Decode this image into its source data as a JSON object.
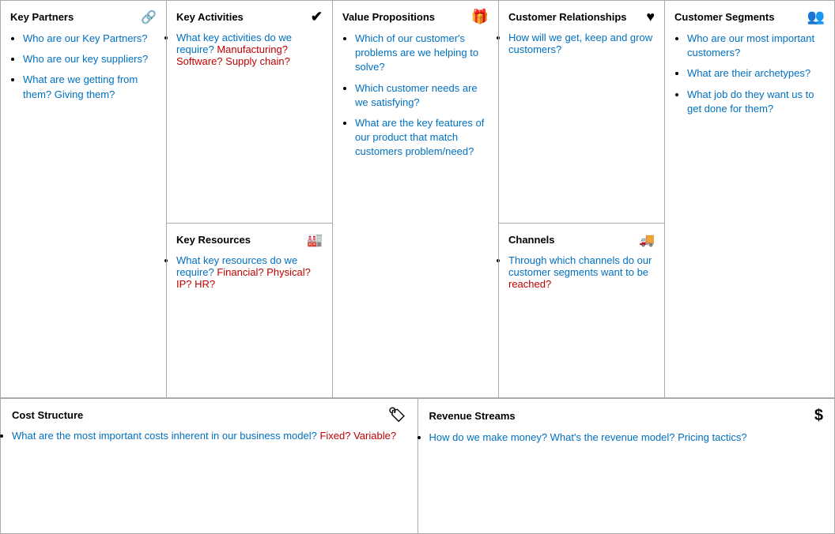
{
  "sections": {
    "keyPartners": {
      "title": "Key Partners",
      "icon": "link-icon",
      "items": [
        {
          "parts": [
            {
              "text": "Who are our Key Partners?",
              "color": "blue"
            }
          ]
        },
        {
          "parts": [
            {
              "text": "Who are our key suppliers?",
              "color": "blue"
            }
          ]
        },
        {
          "parts": [
            {
              "text": "What are we getting from them? Giving them?",
              "color": "blue"
            }
          ]
        }
      ]
    },
    "keyActivities": {
      "title": "Key Activities",
      "icon": "check-icon",
      "items": [
        {
          "parts": [
            {
              "text": "What key activities do we require? ",
              "color": "blue"
            },
            {
              "text": "Manufacturing? Software? Supply chain?",
              "color": "red"
            }
          ]
        }
      ]
    },
    "keyResources": {
      "title": "Key Resources",
      "icon": "factory-icon",
      "items": [
        {
          "parts": [
            {
              "text": "What key resources do we require? ",
              "color": "blue"
            },
            {
              "text": "Financial? Physical? IP? HR?",
              "color": "red"
            }
          ]
        }
      ]
    },
    "valuePropositions": {
      "title": "Value Propositions",
      "icon": "gift-icon",
      "items": [
        {
          "parts": [
            {
              "text": "Which of our customer's problems are we helping to solve?",
              "color": "blue"
            }
          ]
        },
        {
          "parts": [
            {
              "text": "Which customer needs are we satisfying?",
              "color": "blue"
            }
          ]
        },
        {
          "parts": [
            {
              "text": "What are the key features of our product that match customers problem/need?",
              "color": "blue"
            }
          ]
        }
      ]
    },
    "customerRelationships": {
      "title": "Customer Relationships",
      "icon": "heart-icon",
      "items": [
        {
          "parts": [
            {
              "text": "How will we get, keep and grow customers?",
              "color": "blue"
            }
          ]
        }
      ]
    },
    "channels": {
      "title": "Channels",
      "icon": "truck-icon",
      "items": [
        {
          "parts": [
            {
              "text": "Through which channels do our customer segments want to be ",
              "color": "blue"
            },
            {
              "text": "reached?",
              "color": "red"
            }
          ]
        }
      ]
    },
    "customerSegments": {
      "title": "Customer Segments",
      "icon": "people-icon",
      "items": [
        {
          "parts": [
            {
              "text": "Who are our most important customers?",
              "color": "blue"
            }
          ]
        },
        {
          "parts": [
            {
              "text": "What are their archetypes?",
              "color": "blue"
            }
          ]
        },
        {
          "parts": [
            {
              "text": "What job do they want us to get done for them?",
              "color": "blue"
            }
          ]
        }
      ]
    },
    "costStructure": {
      "title": "Cost Structure",
      "icon": "tag-icon",
      "items": [
        {
          "parts": [
            {
              "text": "What are the most important costs inherent in our business model? ",
              "color": "blue"
            },
            {
              "text": "Fixed? Variable?",
              "color": "red"
            }
          ]
        }
      ]
    },
    "revenueStreams": {
      "title": "Revenue Streams",
      "icon": "dollar-icon",
      "items": [
        {
          "parts": [
            {
              "text": "How do we make money? What's the revenue model? Pricing tactics?",
              "color": "blue"
            }
          ]
        }
      ]
    }
  }
}
